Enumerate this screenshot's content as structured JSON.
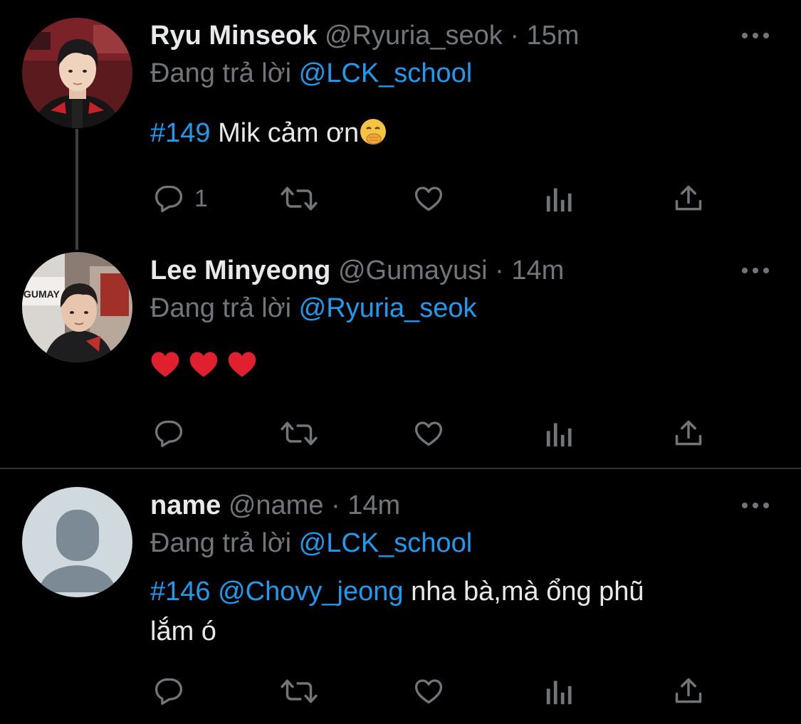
{
  "colors": {
    "background": "#000000",
    "text": "#e7e9ea",
    "muted": "#71767b",
    "link": "#1d9bf0",
    "divider": "#2f3336",
    "heart": "#e0202e"
  },
  "tweets": [
    {
      "name": "Ryu Minseok",
      "handle": "@Ryuria_seok",
      "separator": "·",
      "time": "15m",
      "replying_prefix": "Đang trả lời",
      "replying_to": "@LCK_school",
      "hashtag": "#149",
      "text": "Mik cảm ơn",
      "emoji": "face-with-hand-over-mouth",
      "reply_count": "1",
      "avatar": "profile-photo"
    },
    {
      "name": "Lee Minyeong",
      "handle": "@Gumayusi",
      "separator": "·",
      "time": "14m",
      "replying_prefix": "Đang trả lời",
      "replying_to": "@Ryuria_seok",
      "emoji": "red-heart",
      "emoji_count": 3,
      "avatar": "profile-photo"
    },
    {
      "name": "name",
      "handle": "@name",
      "separator": "·",
      "time": "14m",
      "replying_prefix": "Đang trả lời",
      "replying_to": "@LCK_school",
      "hashtag": "#146",
      "mention": "@Chovy_jeong",
      "text_line1": " nha bà,mà ổng phũ",
      "text_line2": "lắm ó",
      "avatar": "default-avatar"
    }
  ],
  "action_icons": [
    "reply-icon",
    "retweet-icon",
    "like-icon",
    "analytics-icon",
    "share-icon"
  ]
}
